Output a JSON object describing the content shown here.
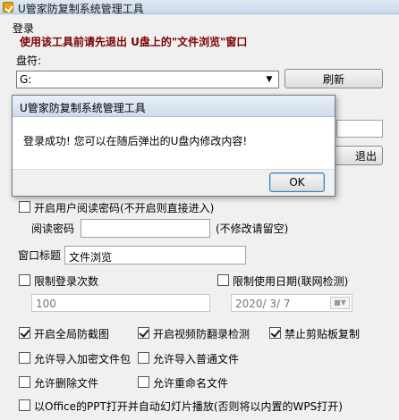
{
  "window": {
    "title": "U管家防复制系统管理工具"
  },
  "login": {
    "section_label": "登录",
    "warning": "使用该工具前请先退出 U盘上的\"文件浏览\"窗口",
    "drive_label": "盘符:",
    "drive_value": "G:",
    "refresh_button": "刷新",
    "exit_button_visible": "退出"
  },
  "dialog": {
    "title": "U管家防复制系统管理工具",
    "message": "登录成功! 您可以在随后弹出的U盘内修改内容!",
    "ok_button": "OK"
  },
  "settings": {
    "read_password_checkbox": {
      "label": "开启用户阅读密码(不开启则直接进入)",
      "checked": false
    },
    "read_password_label": "阅读密码",
    "read_password_value": "",
    "read_password_hint": "(不修改请留空)",
    "window_title_label": "窗口标题",
    "window_title_value": "文件浏览",
    "limit_login_checkbox": {
      "label": "限制登录次数",
      "checked": false
    },
    "limit_login_value": "100",
    "limit_date_checkbox": {
      "label": "限制使用日期(联网检测)",
      "checked": false
    },
    "limit_date_value": "2020/ 3/ 7",
    "screenshot_checkbox": {
      "label": "开启全局防截图",
      "checked": true
    },
    "video_record_checkbox": {
      "label": "开启视频防翻录检测",
      "checked": true
    },
    "clipboard_checkbox": {
      "label": "禁止剪贴板复制",
      "checked": true
    },
    "import_encrypted_checkbox": {
      "label": "允许导入加密文件包",
      "checked": false
    },
    "import_normal_checkbox": {
      "label": "允许导入普通文件",
      "checked": false
    },
    "delete_checkbox": {
      "label": "允许删除文件",
      "checked": false
    },
    "rename_checkbox": {
      "label": "允许重命名文件",
      "checked": false
    },
    "ppt_checkbox": {
      "label": "以Office的PPT打开并自动幻灯片播放(否则将以内置的WPS打开)",
      "checked": false
    }
  },
  "icons": [
    "app-icon",
    "dropdown-arrow-icon",
    "calendar-icon"
  ]
}
